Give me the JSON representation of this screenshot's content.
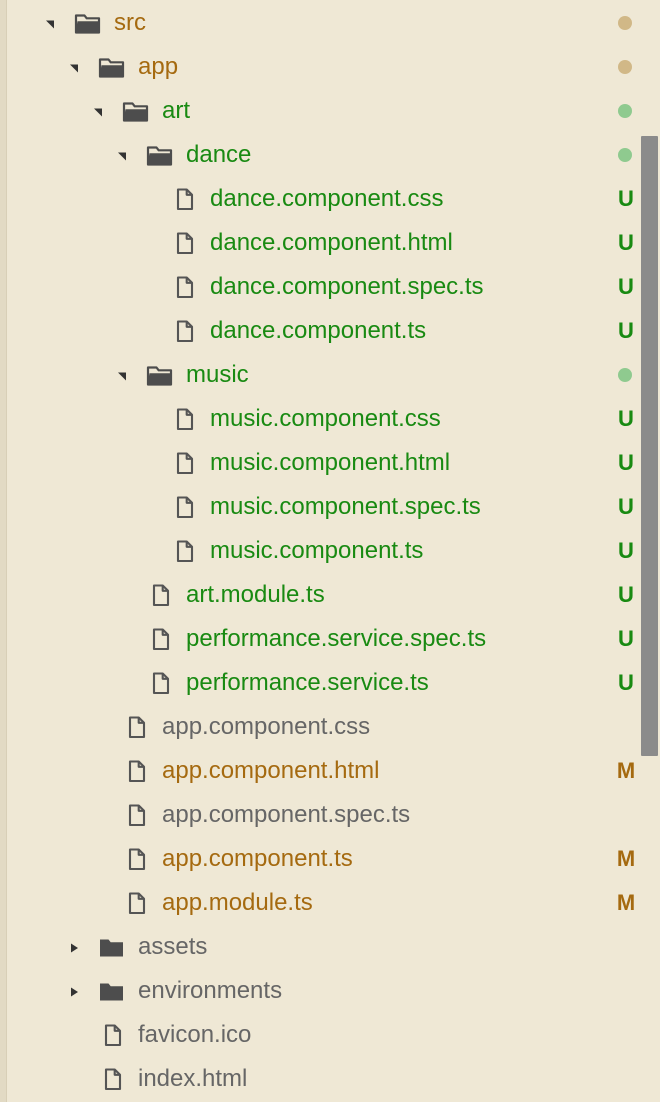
{
  "colors": {
    "background": "#efe8d5",
    "untracked": "#198a12",
    "modified": "#a56a10",
    "normal": "#666666",
    "folder_icon": "#4d4d4d",
    "file_icon": "#555555",
    "dot_modified": "#d1b887",
    "dot_untracked": "#8fca8f"
  },
  "tree": [
    {
      "label": "src",
      "type": "folder",
      "expanded": true,
      "depth": 0,
      "color": "#a56a10",
      "status": "",
      "status_kind": "dot-modified"
    },
    {
      "label": "app",
      "type": "folder",
      "expanded": true,
      "depth": 1,
      "color": "#a56a10",
      "status": "",
      "status_kind": "dot-modified"
    },
    {
      "label": "art",
      "type": "folder",
      "expanded": true,
      "depth": 2,
      "color": "#198a12",
      "status": "",
      "status_kind": "dot-untracked"
    },
    {
      "label": "dance",
      "type": "folder",
      "expanded": true,
      "depth": 3,
      "color": "#198a12",
      "status": "",
      "status_kind": "dot-untracked"
    },
    {
      "label": "dance.component.css",
      "type": "file",
      "depth": 4,
      "color": "#198a12",
      "status": "U",
      "status_kind": "letter-untracked"
    },
    {
      "label": "dance.component.html",
      "type": "file",
      "depth": 4,
      "color": "#198a12",
      "status": "U",
      "status_kind": "letter-untracked"
    },
    {
      "label": "dance.component.spec.ts",
      "type": "file",
      "depth": 4,
      "color": "#198a12",
      "status": "U",
      "status_kind": "letter-untracked"
    },
    {
      "label": "dance.component.ts",
      "type": "file",
      "depth": 4,
      "color": "#198a12",
      "status": "U",
      "status_kind": "letter-untracked"
    },
    {
      "label": "music",
      "type": "folder",
      "expanded": true,
      "depth": 3,
      "color": "#198a12",
      "status": "",
      "status_kind": "dot-untracked"
    },
    {
      "label": "music.component.css",
      "type": "file",
      "depth": 4,
      "color": "#198a12",
      "status": "U",
      "status_kind": "letter-untracked"
    },
    {
      "label": "music.component.html",
      "type": "file",
      "depth": 4,
      "color": "#198a12",
      "status": "U",
      "status_kind": "letter-untracked"
    },
    {
      "label": "music.component.spec.ts",
      "type": "file",
      "depth": 4,
      "color": "#198a12",
      "status": "U",
      "status_kind": "letter-untracked"
    },
    {
      "label": "music.component.ts",
      "type": "file",
      "depth": 4,
      "color": "#198a12",
      "status": "U",
      "status_kind": "letter-untracked"
    },
    {
      "label": "art.module.ts",
      "type": "file",
      "depth": 3,
      "color": "#198a12",
      "status": "U",
      "status_kind": "letter-untracked"
    },
    {
      "label": "performance.service.spec.ts",
      "type": "file",
      "depth": 3,
      "color": "#198a12",
      "status": "U",
      "status_kind": "letter-untracked"
    },
    {
      "label": "performance.service.ts",
      "type": "file",
      "depth": 3,
      "color": "#198a12",
      "status": "U",
      "status_kind": "letter-untracked"
    },
    {
      "label": "app.component.css",
      "type": "file",
      "depth": 2,
      "color": "#666666",
      "status": "",
      "status_kind": "none"
    },
    {
      "label": "app.component.html",
      "type": "file",
      "depth": 2,
      "color": "#a56a10",
      "status": "M",
      "status_kind": "letter-modified"
    },
    {
      "label": "app.component.spec.ts",
      "type": "file",
      "depth": 2,
      "color": "#666666",
      "status": "",
      "status_kind": "none"
    },
    {
      "label": "app.component.ts",
      "type": "file",
      "depth": 2,
      "color": "#a56a10",
      "status": "M",
      "status_kind": "letter-modified"
    },
    {
      "label": "app.module.ts",
      "type": "file",
      "depth": 2,
      "color": "#a56a10",
      "status": "M",
      "status_kind": "letter-modified"
    },
    {
      "label": "assets",
      "type": "folder",
      "expanded": false,
      "depth": 1,
      "color": "#666666",
      "status": "",
      "status_kind": "none"
    },
    {
      "label": "environments",
      "type": "folder",
      "expanded": false,
      "depth": 1,
      "color": "#666666",
      "status": "",
      "status_kind": "none"
    },
    {
      "label": "favicon.ico",
      "type": "file",
      "depth": 1,
      "color": "#666666",
      "status": "",
      "status_kind": "none"
    },
    {
      "label": "index.html",
      "type": "file",
      "depth": 1,
      "color": "#666666",
      "status": "",
      "status_kind": "none"
    }
  ]
}
